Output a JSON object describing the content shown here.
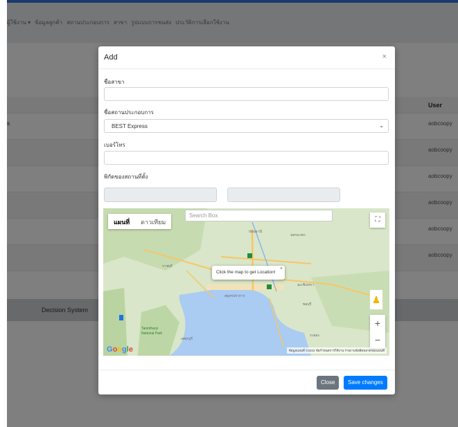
{
  "nav": {
    "items": [
      "ผู้ใช้งาน ▾",
      "ข้อมูลลูกค้า",
      "สถานประกอบการ",
      "สาขา",
      "รูปแบบการขนส่ง",
      "ประวัติการเลือกใช้งาน"
    ]
  },
  "table": {
    "user_header": "User",
    "first_cell": "s",
    "users": [
      "aobcoopy",
      "aobcoopy",
      "aobcoopy",
      "aobcoopy",
      "aobcoopy",
      "aobcoopy"
    ]
  },
  "footer": {
    "brand": "Decision System"
  },
  "modal": {
    "title": "Add",
    "close_symbol": "×",
    "branch_name_label": "ชื่อสาขา",
    "branch_name_value": "",
    "company_label": "ชื่อสถานประกอบการ",
    "company_selected": "BEST Express",
    "phone_label": "เบอร์โทร",
    "phone_value": "",
    "location_label": "พิกัดของสถานที่ตั้ง",
    "lat_value": "",
    "lng_value": "",
    "map": {
      "type_map": "แผนที่",
      "type_satellite": "ดาวเทียม",
      "search_placeholder": "Search Box",
      "info_text": "Click the map to get Location!",
      "info_close": "×",
      "zoom_in": "+",
      "zoom_out": "−",
      "google_logo": "Google",
      "legal": "ข้อมูลแผนที่ ©2022   ข้อกำหนดการใช้งาน   รายงานข้อผิดพลาดของแผนที่",
      "place_labels": [
        "ปทุมธานี",
        "นครนายก",
        "กรุงเทพมหานคร",
        "ฉะเชิงเทรา",
        "ราชบุรี",
        "สมุทรปราการ",
        "เพชรบุรี",
        "ชลบุรี",
        "ระยอง",
        "Tanintharyi National Park"
      ]
    },
    "close_label": "Close",
    "save_label": "Save changes"
  }
}
